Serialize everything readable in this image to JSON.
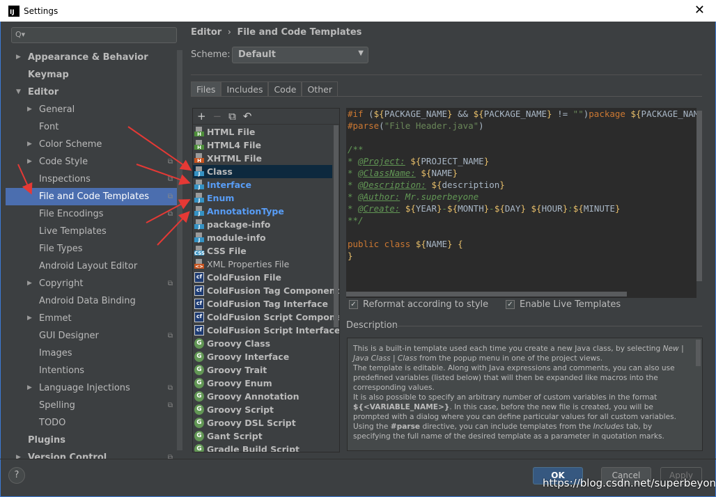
{
  "window": {
    "title": "Settings",
    "close": "✕"
  },
  "sidebar": {
    "search_placeholder": "Q▾",
    "items": [
      {
        "label": "Appearance & Behavior",
        "level": 0,
        "arrow": "▶",
        "bold": true
      },
      {
        "label": "Keymap",
        "level": 0,
        "bold": true
      },
      {
        "label": "Editor",
        "level": 0,
        "arrow": "▼",
        "bold": true
      },
      {
        "label": "General",
        "level": 1,
        "arrow": "▶"
      },
      {
        "label": "Font",
        "level": 1
      },
      {
        "label": "Color Scheme",
        "level": 1,
        "arrow": "▶"
      },
      {
        "label": "Code Style",
        "level": 1,
        "arrow": "▶",
        "copy": true
      },
      {
        "label": "Inspections",
        "level": 1,
        "copy": true
      },
      {
        "label": "File and Code Templates",
        "level": 1,
        "copy": true,
        "selected": true
      },
      {
        "label": "File Encodings",
        "level": 1,
        "copy": true
      },
      {
        "label": "Live Templates",
        "level": 1
      },
      {
        "label": "File Types",
        "level": 1
      },
      {
        "label": "Android Layout Editor",
        "level": 1
      },
      {
        "label": "Copyright",
        "level": 1,
        "arrow": "▶",
        "copy": true
      },
      {
        "label": "Android Data Binding",
        "level": 1
      },
      {
        "label": "Emmet",
        "level": 1,
        "arrow": "▶"
      },
      {
        "label": "GUI Designer",
        "level": 1,
        "copy": true
      },
      {
        "label": "Images",
        "level": 1
      },
      {
        "label": "Intentions",
        "level": 1
      },
      {
        "label": "Language Injections",
        "level": 1,
        "arrow": "▶",
        "copy": true
      },
      {
        "label": "Spelling",
        "level": 1,
        "copy": true
      },
      {
        "label": "TODO",
        "level": 1
      },
      {
        "label": "Plugins",
        "level": 0,
        "bold": true
      },
      {
        "label": "Version Control",
        "level": 0,
        "arrow": "▶",
        "bold": true,
        "copy": true
      }
    ]
  },
  "breadcrumb": {
    "parent": "Editor",
    "sep": "›",
    "current": "File and Code Templates"
  },
  "scheme": {
    "label": "Scheme:",
    "value": "Default"
  },
  "tabs": [
    "Files",
    "Includes",
    "Code",
    "Other"
  ],
  "toolbar": {
    "add": "+",
    "remove": "−",
    "copy": "⧉",
    "reset": "↶"
  },
  "templates": [
    {
      "name": "HTML File",
      "icon": "H",
      "color": "#4e8f3a"
    },
    {
      "name": "HTML4 File",
      "icon": "H",
      "color": "#4e8f3a"
    },
    {
      "name": "XHTML File",
      "icon": "H",
      "color": "#c75420"
    },
    {
      "name": "Class",
      "icon": "J",
      "color": "#3592c4",
      "selected": true
    },
    {
      "name": "Interface",
      "icon": "J",
      "color": "#3592c4",
      "blue": true
    },
    {
      "name": "Enum",
      "icon": "J",
      "color": "#3592c4",
      "blue": true
    },
    {
      "name": "AnnotationType",
      "icon": "J",
      "color": "#3592c4",
      "blue": true
    },
    {
      "name": "package-info",
      "icon": "J",
      "color": "#3592c4"
    },
    {
      "name": "module-info",
      "icon": "J",
      "color": "#3592c4"
    },
    {
      "name": "CSS File",
      "icon": "CSS",
      "color": "#3592c4"
    },
    {
      "name": "XML Properties File",
      "icon": "<>",
      "color": "#c75420",
      "plain": true
    },
    {
      "name": "ColdFusion File",
      "icon": "cf",
      "type": "cf"
    },
    {
      "name": "ColdFusion Tag Component",
      "icon": "cf",
      "type": "cf"
    },
    {
      "name": "ColdFusion Tag Interface",
      "icon": "cf",
      "type": "cf"
    },
    {
      "name": "ColdFusion Script Component",
      "icon": "cf",
      "type": "cf"
    },
    {
      "name": "ColdFusion Script Interface",
      "icon": "cf",
      "type": "cf"
    },
    {
      "name": "Groovy Class",
      "icon": "G",
      "type": "gr"
    },
    {
      "name": "Groovy Interface",
      "icon": "G",
      "type": "gr"
    },
    {
      "name": "Groovy Trait",
      "icon": "G",
      "type": "gr"
    },
    {
      "name": "Groovy Enum",
      "icon": "G",
      "type": "gr"
    },
    {
      "name": "Groovy Annotation",
      "icon": "G",
      "type": "gr"
    },
    {
      "name": "Groovy Script",
      "icon": "G",
      "type": "gr"
    },
    {
      "name": "Groovy DSL Script",
      "icon": "G",
      "type": "gr"
    },
    {
      "name": "Gant Script",
      "icon": "G",
      "type": "gr"
    },
    {
      "name": "Gradle Build Script",
      "icon": "G",
      "type": "gr"
    }
  ],
  "editor": {
    "lines": [
      [
        [
          "k",
          "#if "
        ],
        [
          "w",
          "("
        ],
        [
          "d",
          "${"
        ],
        [
          "v",
          "PACKAGE_NAME"
        ],
        [
          "d",
          "}"
        ],
        [
          "w",
          " && "
        ],
        [
          "d",
          "${"
        ],
        [
          "v",
          "PACKAGE_NAME"
        ],
        [
          "d",
          "}"
        ],
        [
          "w",
          " != "
        ],
        [
          "s",
          "\"\""
        ],
        [
          "w",
          ")"
        ],
        [
          "k",
          "package "
        ],
        [
          "d",
          "${"
        ],
        [
          "v",
          "PACKAGE_NAME"
        ],
        [
          "d",
          "}"
        ]
      ],
      [
        [
          "k",
          "#parse"
        ],
        [
          "w",
          "("
        ],
        [
          "s",
          "\"File Header.java\""
        ],
        [
          "w",
          ")"
        ]
      ],
      [],
      [
        [
          "c",
          "/**"
        ]
      ],
      [
        [
          "c",
          "* "
        ],
        [
          "t",
          "@Project:"
        ],
        [
          "c",
          " "
        ],
        [
          "d",
          "${"
        ],
        [
          "v",
          "PROJECT_NAME"
        ],
        [
          "d",
          "}"
        ]
      ],
      [
        [
          "c",
          "* "
        ],
        [
          "t",
          "@ClassName:"
        ],
        [
          "c",
          " "
        ],
        [
          "d",
          "${"
        ],
        [
          "v",
          "NAME"
        ],
        [
          "d",
          "}"
        ]
      ],
      [
        [
          "c",
          "* "
        ],
        [
          "t",
          "@Description:"
        ],
        [
          "c",
          " "
        ],
        [
          "d",
          "${"
        ],
        [
          "v",
          "description"
        ],
        [
          "d",
          "}"
        ]
      ],
      [
        [
          "c",
          "* "
        ],
        [
          "t",
          "@Author:"
        ],
        [
          "c",
          " Mr.superbeyone"
        ]
      ],
      [
        [
          "c",
          "* "
        ],
        [
          "t",
          "@Create:"
        ],
        [
          "c",
          " "
        ],
        [
          "d",
          "${"
        ],
        [
          "v",
          "YEAR"
        ],
        [
          "d",
          "}"
        ],
        [
          "c",
          "-"
        ],
        [
          "d",
          "${"
        ],
        [
          "v",
          "MONTH"
        ],
        [
          "d",
          "}"
        ],
        [
          "c",
          "-"
        ],
        [
          "d",
          "${"
        ],
        [
          "v",
          "DAY"
        ],
        [
          "d",
          "}"
        ],
        [
          "c",
          " "
        ],
        [
          "d",
          "${"
        ],
        [
          "v",
          "HOUR"
        ],
        [
          "d",
          "}"
        ],
        [
          "c",
          ":"
        ],
        [
          "d",
          "${"
        ],
        [
          "v",
          "MINUTE"
        ],
        [
          "d",
          "}"
        ]
      ],
      [
        [
          "c",
          "**/"
        ]
      ],
      [],
      [
        [
          "k",
          "public class "
        ],
        [
          "d",
          "${"
        ],
        [
          "v",
          "NAME"
        ],
        [
          "d",
          "}"
        ],
        [
          "w",
          " "
        ],
        [
          "d",
          "{"
        ]
      ],
      [
        [
          "d",
          "}"
        ]
      ]
    ]
  },
  "options": {
    "reformat": {
      "label": "Reformat according to style",
      "checked": true
    },
    "live": {
      "label": "Enable Live Templates",
      "checked": true
    }
  },
  "description": {
    "label": "Description",
    "p1a": "This is a built-in template used each time you create a new Java class, by selecting ",
    "p1i": "New | Java Class | Class",
    "p1b": " from the popup menu in one of the project views.",
    "p2": "The template is editable. Along with Java expressions and comments, you can also use predefined variables (listed below) that will then be expanded like macros into the corresponding values.",
    "p3a": "It is also possible to specify an arbitrary number of custom variables in the format ",
    "p3b": "${<VARIABLE_NAME>}",
    "p3c": ". In this case, before the new file is created, you will be prompted with a dialog where you can define particular values for all custom variables.",
    "p4a": "Using the ",
    "p4b": "#parse",
    "p4c": " directive, you can include templates from the ",
    "p4i": "Includes",
    "p4d": " tab, by specifying the full name of the desired template as a parameter in quotation marks."
  },
  "buttons": {
    "help": "?",
    "ok": "OK",
    "cancel": "Cancel",
    "apply": "Apply"
  },
  "watermark": "https://blog.csdn.net/superbeyone",
  "colors": {
    "accent": "#4b6eaf",
    "annotation_arrows": "#e53935"
  }
}
